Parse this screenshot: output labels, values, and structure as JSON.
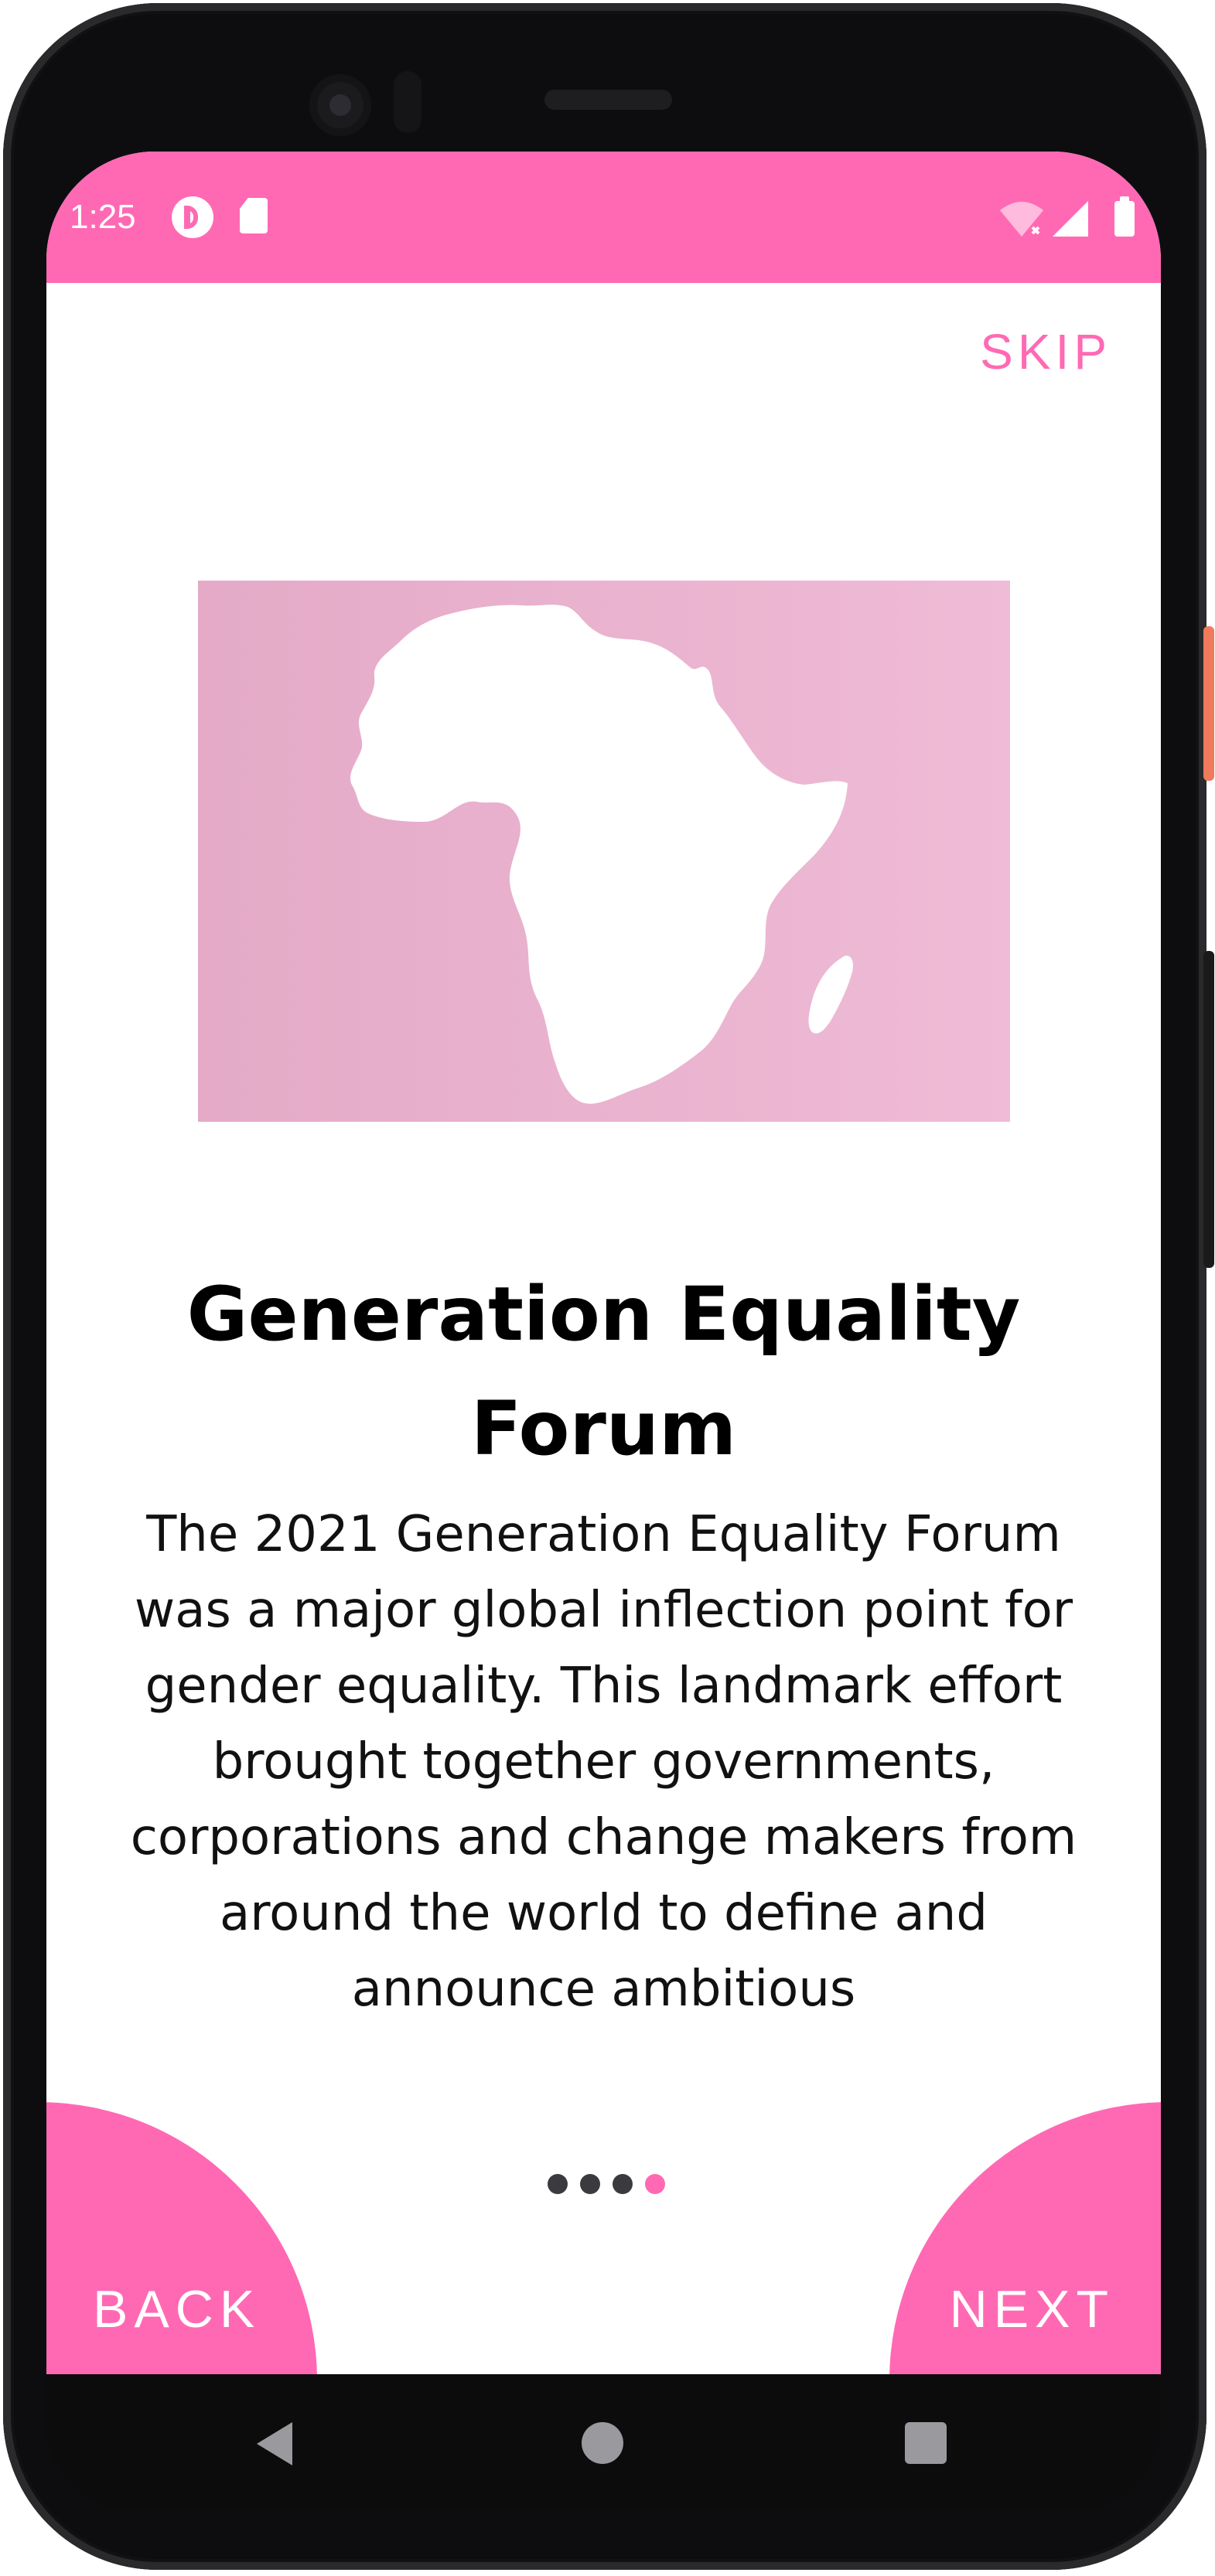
{
  "status_bar": {
    "time": "1:25"
  },
  "onboarding": {
    "skip_label": "SKIP",
    "title": "Generation Equality Forum",
    "description": "The 2021 Generation Equality Forum was a major global inflection point for gender equality. This landmark effort brought together governments, corporations and change makers from around the world to define and announce ambitious",
    "page_indicator": {
      "total": 4,
      "current": 4
    },
    "back_label": "BACK",
    "next_label": "NEXT"
  },
  "colors": {
    "accent": "#ff69b4",
    "hero_left": "#e4aac7",
    "hero_right": "#efbbd6",
    "dot_inactive": "#3a3a3f"
  },
  "icons": {
    "status": [
      "app-notification-icon",
      "sd-card-icon",
      "wifi-icon",
      "cellular-signal-icon",
      "battery-icon"
    ],
    "hero": "africa-map-icon",
    "navigation": [
      "nav-back-icon",
      "nav-home-icon",
      "nav-recents-icon"
    ]
  }
}
